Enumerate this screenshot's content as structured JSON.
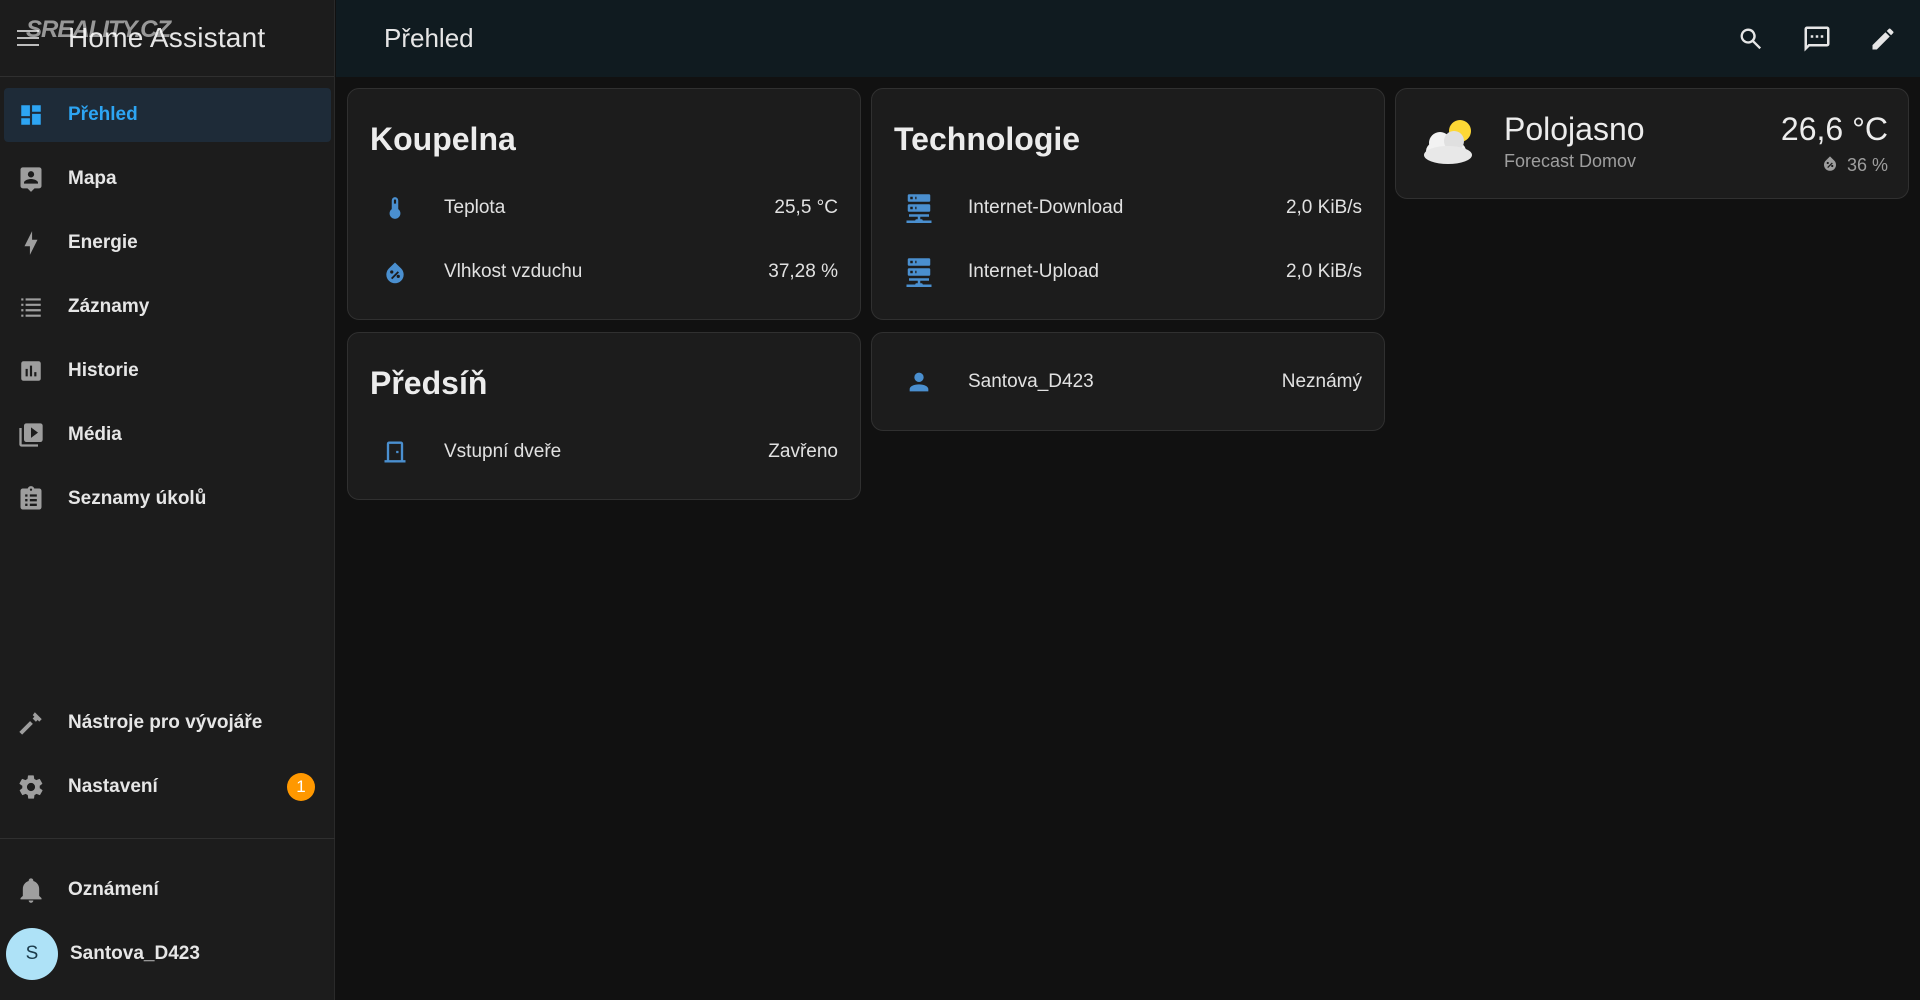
{
  "app": {
    "title": "Home Assistant",
    "watermark": "SREALITY.CZ"
  },
  "sidebar": {
    "items": [
      {
        "label": "Přehled",
        "icon": "dashboard-icon"
      },
      {
        "label": "Mapa",
        "icon": "map-account-icon"
      },
      {
        "label": "Energie",
        "icon": "lightning-icon"
      },
      {
        "label": "Záznamy",
        "icon": "list-icon"
      },
      {
        "label": "Historie",
        "icon": "chart-box-icon"
      },
      {
        "label": "Média",
        "icon": "media-play-icon"
      },
      {
        "label": "Seznamy úkolů",
        "icon": "clipboard-list-icon"
      }
    ],
    "dev_tools": {
      "label": "Nástroje pro vývojáře",
      "icon": "hammer-icon"
    },
    "settings": {
      "label": "Nastavení",
      "icon": "gear-icon",
      "badge": "1"
    },
    "notifications": {
      "label": "Oznámení",
      "icon": "bell-icon"
    },
    "user": {
      "label": "Santova_D423",
      "initial": "S"
    }
  },
  "header": {
    "title": "Přehled"
  },
  "cards": {
    "koupelna": {
      "title": "Koupelna",
      "rows": [
        {
          "name": "Teplota",
          "value": "25,5 °C",
          "icon": "thermometer-icon"
        },
        {
          "name": "Vlhkost vzduchu",
          "value": "37,28 %",
          "icon": "water-percent-icon"
        }
      ]
    },
    "technologie": {
      "title": "Technologie",
      "rows": [
        {
          "name": "Internet-Download",
          "value": "2,0 KiB/s",
          "icon": "server-icon"
        },
        {
          "name": "Internet-Upload",
          "value": "2,0 KiB/s",
          "icon": "server-icon"
        }
      ]
    },
    "weather": {
      "condition": "Polojasno",
      "location": "Forecast Domov",
      "temperature": "26,6 °C",
      "humidity": "36 %"
    },
    "predsin": {
      "title": "Předsíň",
      "rows": [
        {
          "name": "Vstupní dveře",
          "value": "Zavřeno",
          "icon": "door-closed-icon"
        }
      ]
    },
    "person": {
      "rows": [
        {
          "name": "Santova_D423",
          "value": "Neznámý",
          "icon": "account-icon"
        }
      ]
    }
  },
  "colors": {
    "accent": "#2da5f3",
    "icon_blue": "#4a8fcf",
    "badge": "#ff9800",
    "background": "#111111",
    "card": "#1c1c1c"
  }
}
